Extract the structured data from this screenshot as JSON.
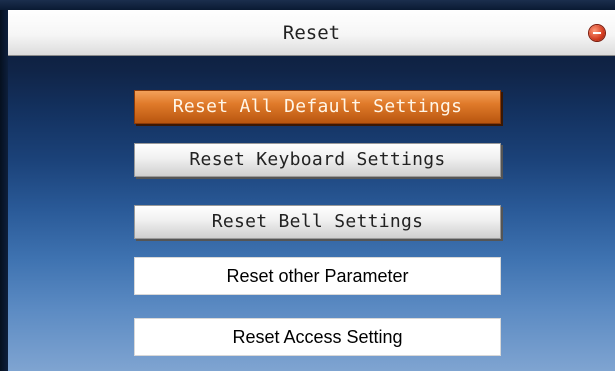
{
  "dialog": {
    "title": "Reset"
  },
  "menu": {
    "items": [
      {
        "label": "Reset All Default Settings",
        "selected": true
      },
      {
        "label": "Reset Keyboard Settings",
        "selected": false
      },
      {
        "label": "Reset Bell Settings",
        "selected": false
      },
      {
        "label": "Reset other Parameter",
        "selected": false
      },
      {
        "label": "Reset Access Setting",
        "selected": false
      }
    ]
  },
  "colors": {
    "selected_item": "#e07a2a",
    "background_top": "#0a1a33",
    "background_bottom": "#7fa4d1"
  },
  "icons": {
    "close": "close-icon"
  }
}
